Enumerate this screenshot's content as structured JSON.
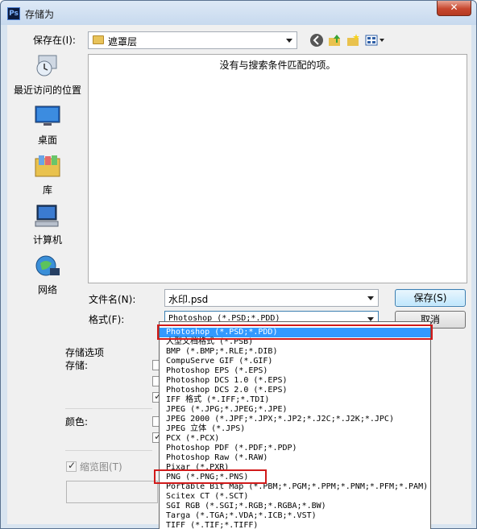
{
  "window": {
    "title": "存储为",
    "app_icon": "Ps",
    "close": "✕"
  },
  "toolbar": {
    "save_in_label": "保存在(I):",
    "location": "遮罩层",
    "icons": [
      "back-icon",
      "up-folder-icon",
      "new-folder-icon",
      "view-menu-icon"
    ]
  },
  "places": [
    {
      "label": "最近访问的位置",
      "icon": "recent-places-icon"
    },
    {
      "label": "桌面",
      "icon": "desktop-icon"
    },
    {
      "label": "库",
      "icon": "library-icon"
    },
    {
      "label": "计算机",
      "icon": "computer-icon"
    },
    {
      "label": "网络",
      "icon": "network-icon"
    }
  ],
  "file_list": {
    "empty_message": "没有与搜索条件匹配的项。"
  },
  "filename": {
    "label": "文件名(N):",
    "value": "水印.psd"
  },
  "format": {
    "label": "格式(F):",
    "value": "Photoshop (*.PSD;*.PDD)"
  },
  "buttons": {
    "save": "保存(S)",
    "cancel": "取消"
  },
  "save_options": {
    "group_label": "存储选项",
    "save_label": "存储:",
    "color_label": "颜色:",
    "thumbnail_label": "缩览图(T)"
  },
  "format_options": [
    "Photoshop (*.PSD;*.PDD)",
    "大型文档格式 (*.PSB)",
    "BMP (*.BMP;*.RLE;*.DIB)",
    "CompuServe GIF (*.GIF)",
    "Photoshop EPS (*.EPS)",
    "Photoshop DCS 1.0 (*.EPS)",
    "Photoshop DCS 2.0 (*.EPS)",
    "IFF 格式 (*.IFF;*.TDI)",
    "JPEG (*.JPG;*.JPEG;*.JPE)",
    "JPEG 2000 (*.JPF;*.JPX;*.JP2;*.J2C;*.J2K;*.JPC)",
    "JPEG 立体 (*.JPS)",
    "PCX (*.PCX)",
    "Photoshop PDF (*.PDF;*.PDP)",
    "Photoshop Raw (*.RAW)",
    "Pixar (*.PXR)",
    "PNG (*.PNG;*.PNS)",
    "Portable Bit Map (*.PBM;*.PGM;*.PPM;*.PNM;*.PFM;*.PAM)",
    "Scitex CT (*.SCT)",
    "SGI RGB (*.SGI;*.RGB;*.RGBA;*.BW)",
    "Targa (*.TGA;*.VDA;*.ICB;*.VST)",
    "TIFF (*.TIF;*.TIFF)"
  ],
  "selected_format_index": 0,
  "highlighted_options": [
    0,
    15
  ],
  "colors": {
    "highlight_box": "#d11a1a",
    "selection": "#3399ff"
  }
}
